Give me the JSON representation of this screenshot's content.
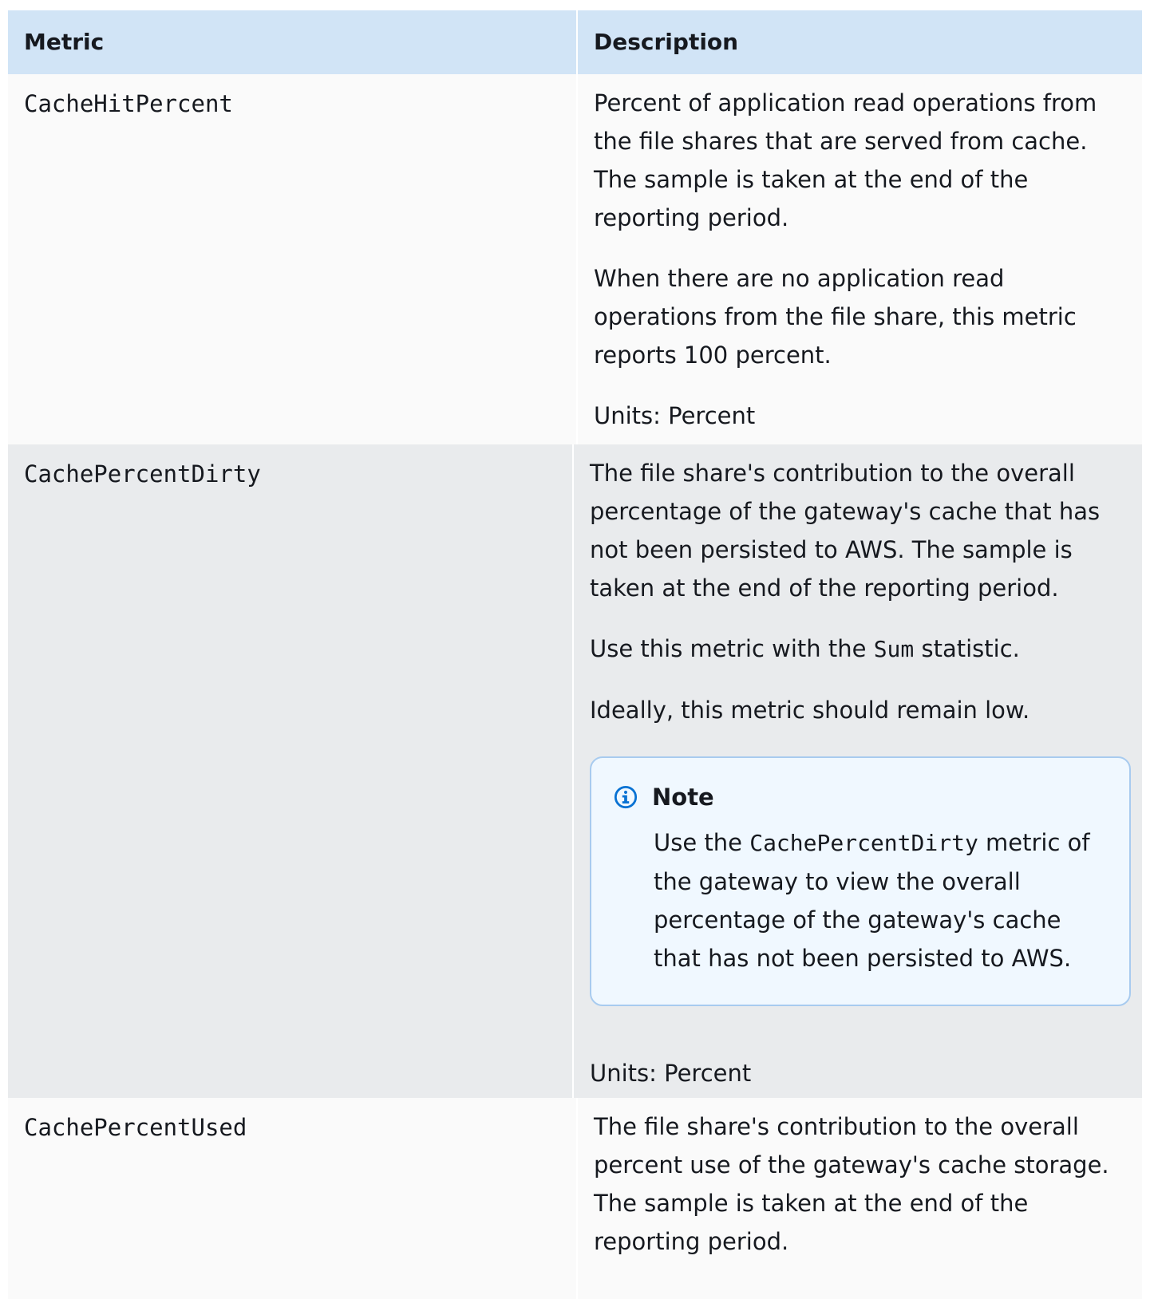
{
  "table": {
    "headers": {
      "metric": "Metric",
      "description": "Description"
    },
    "rows": [
      {
        "metric": "CacheHitPercent",
        "p1": "Percent of application read operations from the file shares that are served from cache. The sample is taken at the end of the reporting period.",
        "p2": "When there are no application read operations from the file share, this metric reports 100 percent.",
        "units": "Units: Percent"
      },
      {
        "metric": "CachePercentDirty",
        "p1": "The file share's contribution to the overall percentage of the gateway's cache that has not been persisted to AWS. The sample is taken at the end of the reporting period.",
        "p2_before": "Use this metric with the ",
        "p2_code": "Sum",
        "p2_after": " statistic.",
        "p3": "Ideally, this metric should remain low.",
        "note": {
          "title": "Note",
          "before": "Use the ",
          "code": "CachePercentDirty",
          "after": " metric of the gateway to view the overall percentage of the gateway's cache that has not been persisted to AWS."
        },
        "units": "Units: Percent"
      },
      {
        "metric": "CachePercentUsed",
        "p1": "The file share's contribution to the overall percent use of the gateway's cache storage. The sample is taken at the end of the reporting period."
      }
    ]
  },
  "colors": {
    "header_bg": "#d1e4f6",
    "row_white": "#fafafa",
    "row_grey": "#e9ebed",
    "note_bg": "#f0f8ff",
    "note_border": "#a8cbef",
    "info_icon": "#0972d3"
  },
  "icons": {
    "note": "info-circle-icon"
  }
}
